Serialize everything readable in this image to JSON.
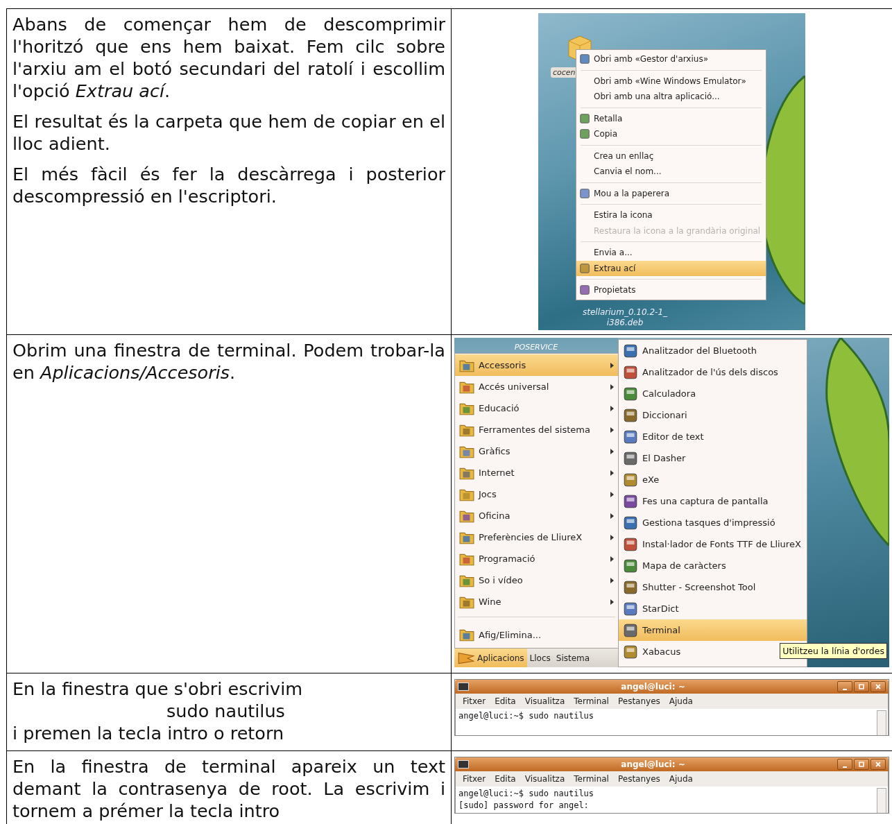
{
  "rows": [
    {
      "paragraphs": [
        {
          "kind": "paragraph",
          "text": "Abans de començar hem de descomprimir l'horitzó que ens hem baixat. Fem cilc sobre l'arxiu am el botó secundari del ratolí i escollim l'opció *Extrau ací*."
        },
        {
          "kind": "paragraph",
          "text": "El resultat és la carpeta que hem de copiar en el lloc adient."
        },
        {
          "kind": "paragraph",
          "text": "El més fàcil és fer la descàrrega i posterior descompressió en l'escriptori."
        }
      ],
      "screenshot": {
        "kind": "context_menu",
        "file_label": "cocen",
        "file_name_lines": [
          "stellarium_0.10.2-1_",
          "i386.deb"
        ],
        "menu": [
          [
            {
              "label": "Obri amb «Gestor d'arxius»",
              "icon": true,
              "selected": false,
              "disabled": false
            }
          ],
          [
            {
              "label": "Obri amb «Wine Windows Emulator»",
              "icon": false,
              "selected": false,
              "disabled": false
            },
            {
              "label": "Obri amb una altra aplicació...",
              "icon": false,
              "selected": false,
              "disabled": false
            }
          ],
          [
            {
              "label": "Retalla",
              "icon": true,
              "selected": false,
              "disabled": false
            },
            {
              "label": "Copia",
              "icon": true,
              "selected": false,
              "disabled": false
            }
          ],
          [
            {
              "label": "Crea un enllaç",
              "icon": false,
              "selected": false,
              "disabled": false
            },
            {
              "label": "Canvia el nom...",
              "icon": false,
              "selected": false,
              "disabled": false
            }
          ],
          [
            {
              "label": "Mou a la paperera",
              "icon": true,
              "selected": false,
              "disabled": false
            }
          ],
          [
            {
              "label": "Estira la icona",
              "icon": false,
              "selected": false,
              "disabled": false
            },
            {
              "label": "Restaura la icona a la grandària original",
              "icon": false,
              "selected": false,
              "disabled": true
            }
          ],
          [
            {
              "label": "Envia a...",
              "icon": false,
              "selected": false,
              "disabled": false
            },
            {
              "label": "Extrau ací",
              "icon": true,
              "selected": true,
              "disabled": false
            }
          ],
          [
            {
              "label": "Propietats",
              "icon": true,
              "selected": false,
              "disabled": false
            }
          ]
        ]
      }
    },
    {
      "paragraphs": [
        {
          "kind": "paragraph",
          "text": "Obrim una finestra de terminal. Podem trobar-la en *Aplicacions/Accesoris*."
        }
      ],
      "screenshot": {
        "kind": "app_menu",
        "desktop_label": "POSERVICE",
        "menu": [
          [
            {
              "label": "Accessoris",
              "has_submenu": true,
              "selected": true
            },
            {
              "label": "Accés universal",
              "has_submenu": true,
              "selected": false
            },
            {
              "label": "Educació",
              "has_submenu": true,
              "selected": false
            },
            {
              "label": "Ferramentes del sistema",
              "has_submenu": true,
              "selected": false
            },
            {
              "label": "Gràfics",
              "has_submenu": true,
              "selected": false
            },
            {
              "label": "Internet",
              "has_submenu": true,
              "selected": false
            },
            {
              "label": "Jocs",
              "has_submenu": true,
              "selected": false
            },
            {
              "label": "Oficina",
              "has_submenu": true,
              "selected": false
            },
            {
              "label": "Preferències de LliureX",
              "has_submenu": true,
              "selected": false
            },
            {
              "label": "Programació",
              "has_submenu": true,
              "selected": false
            },
            {
              "label": "So i vídeo",
              "has_submenu": true,
              "selected": false
            },
            {
              "label": "Wine",
              "has_submenu": true,
              "selected": false
            }
          ],
          [
            {
              "label": "Afig/Elimina...",
              "has_submenu": false,
              "selected": false
            }
          ]
        ],
        "panel": [
          {
            "label": "Aplicacions",
            "selected": true
          },
          {
            "label": "Llocs",
            "selected": false
          },
          {
            "label": "Sistema",
            "selected": false
          }
        ],
        "submenu": [
          {
            "label": "Analitzador del Bluetooth",
            "selected": false
          },
          {
            "label": "Analitzador de l'ús dels discos",
            "selected": false
          },
          {
            "label": "Calculadora",
            "selected": false
          },
          {
            "label": "Diccionari",
            "selected": false
          },
          {
            "label": "Editor de text",
            "selected": false
          },
          {
            "label": "El Dasher",
            "selected": false
          },
          {
            "label": "eXe",
            "selected": false
          },
          {
            "label": "Fes una captura de pantalla",
            "selected": false
          },
          {
            "label": "Gestiona tasques d'impressió",
            "selected": false
          },
          {
            "label": "Instal·lador de Fonts TTF de LliureX",
            "selected": false
          },
          {
            "label": "Mapa de caràcters",
            "selected": false
          },
          {
            "label": "Shutter - Screenshot Tool",
            "selected": false
          },
          {
            "label": "StarDict",
            "selected": false
          },
          {
            "label": "Terminal",
            "selected": true
          },
          {
            "label": "Xabacus",
            "selected": false
          }
        ],
        "tooltip": "Utilitzeu la línia d'ordes"
      }
    },
    {
      "paragraphs": [
        {
          "kind": "line",
          "text": "En la finestra que s'obri escrivim"
        },
        {
          "kind": "command",
          "text": "sudo nautilus"
        },
        {
          "kind": "line",
          "text": "i premen la tecla intro o retorn"
        }
      ],
      "screenshot": {
        "kind": "terminal",
        "title": "angel@luci: ~",
        "menus": [
          "Fitxer",
          "Edita",
          "Visualitza",
          "Terminal",
          "Pestanyes",
          "Ajuda"
        ],
        "lines": [
          "angel@luci:~$ sudo nautilus"
        ]
      }
    },
    {
      "paragraphs": [
        {
          "kind": "paragraph",
          "text": "En la finestra de terminal apareix un text demant la contrasenya de root. La escrivim i tornem a prémer la tecla intro"
        }
      ],
      "screenshot": {
        "kind": "terminal",
        "title": "angel@luci: ~",
        "menus": [
          "Fitxer",
          "Edita",
          "Visualitza",
          "Terminal",
          "Pestanyes",
          "Ajuda"
        ],
        "lines": [
          "angel@luci:~$ sudo nautilus",
          "[sudo] password for angel:"
        ]
      }
    }
  ]
}
